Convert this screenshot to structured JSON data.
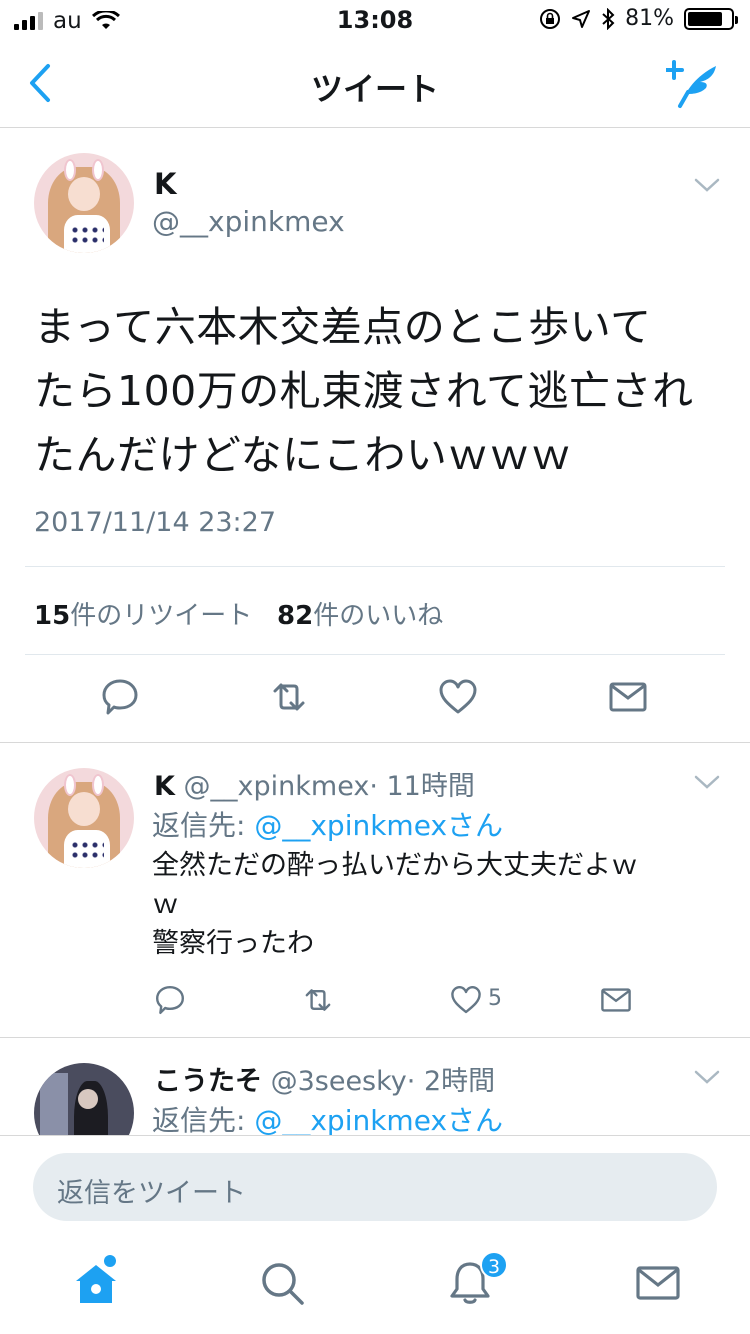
{
  "status_bar": {
    "carrier": "au",
    "time": "13:08",
    "battery": "81%",
    "battery_level": 0.81
  },
  "nav": {
    "title": "ツイート"
  },
  "main_tweet": {
    "name": "K",
    "handle": "@__xpinkmex",
    "text_lines": [
      "まって六本木交差点のとこ歩いて",
      "たら100万の札束渡されて逃亡され",
      "たんだけどなにこわいｗｗｗ"
    ],
    "date": "2017/11/14 23:27",
    "retweet_count": "15",
    "retweet_label": "件のリツイート",
    "like_count": "82",
    "like_label": "件のいいね"
  },
  "replies": [
    {
      "name": "K",
      "handle": "@__xpinkmex",
      "time": "· 11時間",
      "reply_to_prefix": "返信先: ",
      "reply_to_user": "@__xpinkmexさん",
      "text_lines": [
        "全然ただの酔っ払いだから大丈夫だよｗ",
        "ｗ",
        "警察行ったわ"
      ],
      "like_count": "5"
    },
    {
      "name": "こうたそ",
      "handle": "@3seesky",
      "time": "· 2時間",
      "reply_to_prefix": "返信先: ",
      "reply_to_user": "@__xpinkmexさん"
    }
  ],
  "composer": {
    "placeholder": "返信をツイート"
  },
  "tabbar": {
    "notification_badge": "3"
  },
  "colors": {
    "accent": "#1da1f2",
    "secondary_text": "#657786",
    "icon_gray": "#657786"
  }
}
